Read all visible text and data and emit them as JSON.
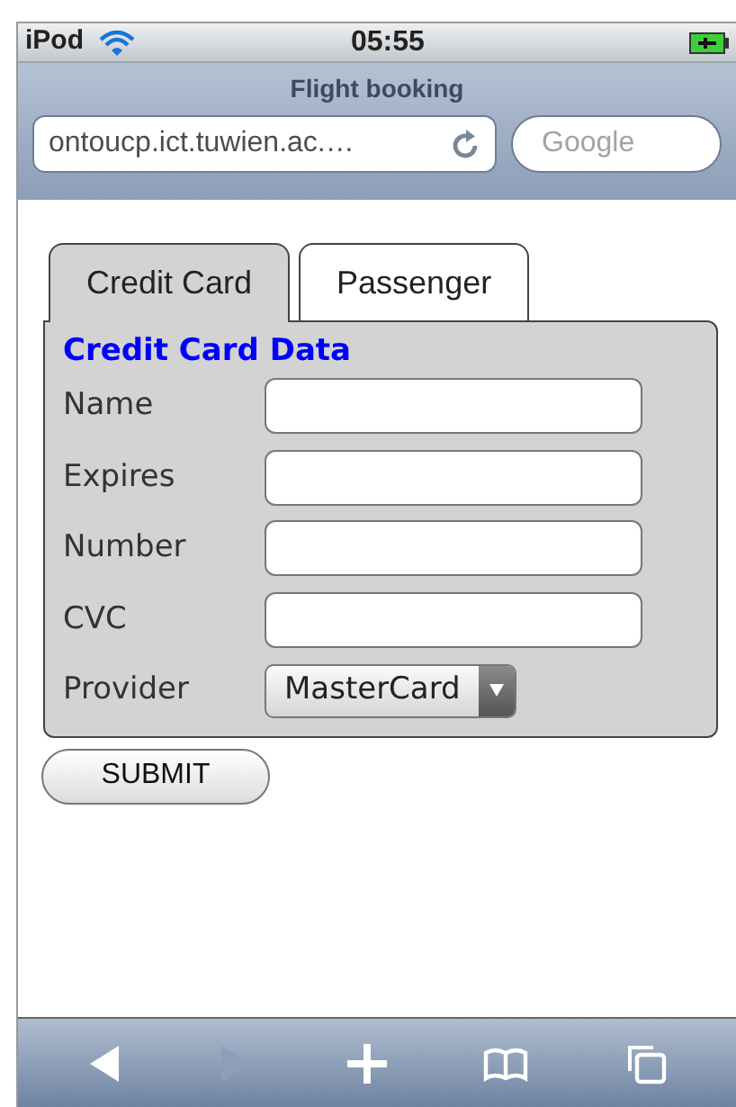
{
  "status_bar": {
    "carrier": "iPod",
    "time": "05:55"
  },
  "browser": {
    "title": "Flight booking",
    "url": "ontoucp.ict.tuwien.ac.…",
    "search": {
      "placeholder": "Google"
    }
  },
  "tabs": [
    {
      "label": "Credit Card",
      "selected": true
    },
    {
      "label": "Passenger",
      "selected": false
    }
  ],
  "panel": {
    "heading": "Credit Card Data",
    "fields": [
      {
        "kind": "text",
        "label": "Name"
      },
      {
        "kind": "text",
        "label": "Expires"
      },
      {
        "kind": "text",
        "label": "Number"
      },
      {
        "kind": "text",
        "label": "CVC"
      },
      {
        "kind": "select",
        "label": "Provider",
        "value": "MasterCard"
      }
    ]
  },
  "submit": "SUBMIT",
  "toolbar": [
    {
      "kind": "back",
      "disabled": false
    },
    {
      "kind": "forward",
      "disabled": true
    },
    {
      "kind": "add",
      "disabled": false
    },
    {
      "kind": "bookmarks",
      "disabled": false
    },
    {
      "kind": "pages",
      "disabled": false
    }
  ]
}
